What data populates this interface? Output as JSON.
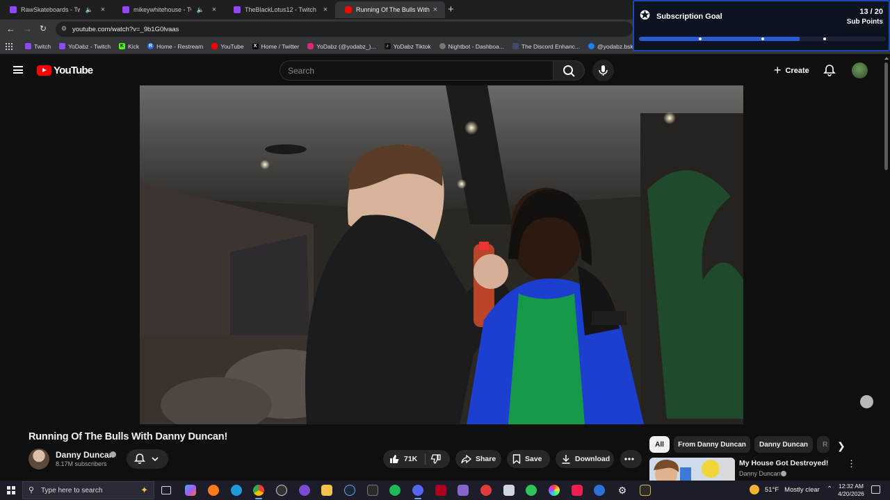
{
  "browser": {
    "tabs": [
      {
        "title": "RawSkateboards - Twitch",
        "active": false
      },
      {
        "title": "mikeywhitehouse - Twitch",
        "active": false
      },
      {
        "title": "TheBlackLotus12 - Twitch",
        "active": false
      },
      {
        "title": "Running Of The Bulls With Danny",
        "active": true
      }
    ],
    "new_tab_glyph": "+",
    "url": "youtube.com/watch?v=_9b1G0lvaas",
    "bookmarks": [
      {
        "label": "Twitch",
        "icon": "twitch-icon",
        "color": "#9146ff"
      },
      {
        "label": "YoDabz - Twitch",
        "icon": "twitch-icon",
        "color": "#9146ff"
      },
      {
        "label": "Kick",
        "icon": "kick-icon",
        "color": "#53fc18"
      },
      {
        "label": "Home - Restream",
        "icon": "restream-icon",
        "color": "#1f6bff"
      },
      {
        "label": "YouTube",
        "icon": "youtube-icon",
        "color": "#ff0000"
      },
      {
        "label": "Home / Twitter",
        "icon": "x-icon",
        "color": "#000000"
      },
      {
        "label": "YoDabz (@yodabz_)...",
        "icon": "instagram-icon",
        "color": "#d62976"
      },
      {
        "label": "YoDabz Tiktok",
        "icon": "tiktok-icon",
        "color": "#111111"
      },
      {
        "label": "Nightbot - Dashboa...",
        "icon": "nightbot-icon",
        "color": "#555555"
      },
      {
        "label": "The Discord Enhanc...",
        "icon": "discord-enhance-icon",
        "color": "#444a66"
      },
      {
        "label": "@yodabz.bsky.socia...",
        "icon": "bluesky-icon",
        "color": "#1185fe"
      }
    ]
  },
  "sub_goal": {
    "title": "Subscription Goal",
    "count": "13 / 20",
    "unit": "Sub Points",
    "progress": 0.65
  },
  "youtube": {
    "logo_text": "YouTube",
    "search_placeholder": "Search",
    "create_label": "Create",
    "video": {
      "title": "Running Of The Bulls With Danny Duncan!",
      "channel": "Danny Duncan",
      "subscribers": "8.17M subscribers",
      "likes": "71K",
      "share_label": "Share",
      "save_label": "Save",
      "download_label": "Download"
    },
    "chips": [
      "All",
      "From Danny Duncan",
      "Danny Duncan",
      "R"
    ],
    "recommendation": {
      "title": "My House Got Destroyed!",
      "channel": "Danny Duncan"
    }
  },
  "taskbar": {
    "search_placeholder": "Type here to search",
    "weather_temp": "51°F",
    "weather_desc": "Mostly clear",
    "time": "12:32 AM",
    "date": "4/20/2026"
  },
  "colors": {
    "youtube_red": "#ff0000",
    "goal_blue": "#2a5bd7",
    "page_bg": "#0f0f0f"
  }
}
